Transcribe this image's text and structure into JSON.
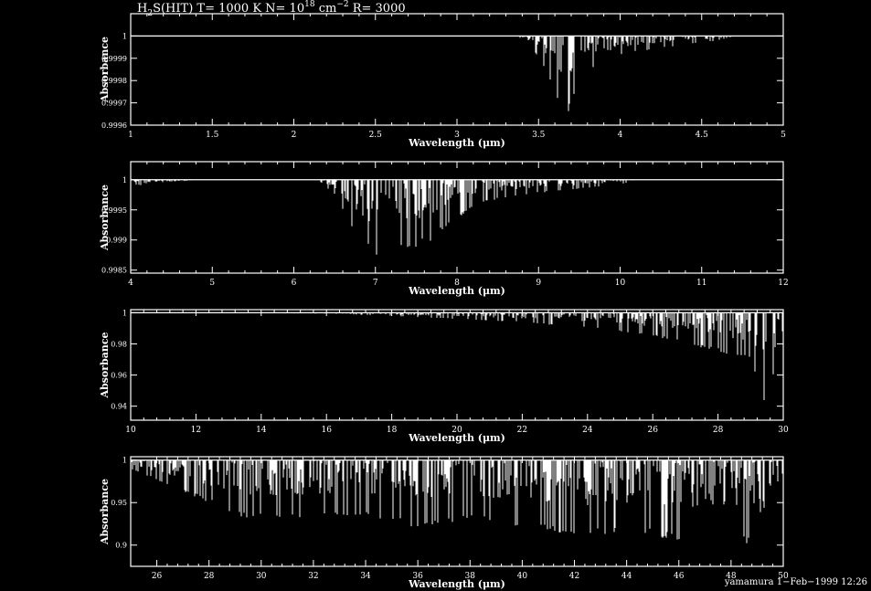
{
  "title": {
    "species": "H",
    "sub": "2",
    "rest": "S(HIT) T= 1000 K N= 10",
    "exp1": "18",
    "unit": " cm",
    "exp2": "−2",
    "res": " R= 3000"
  },
  "footer": "yamamura  1−Feb−1999 12:26",
  "colors": {
    "background": "#000000",
    "foreground": "#ffffff"
  },
  "chart_data": [
    {
      "type": "line",
      "xlabel": "Wavelength (μm)",
      "ylabel": "Absorbance",
      "xlim": [
        1,
        5
      ],
      "ylim": [
        0.9996,
        1.0001
      ],
      "xticks": [
        1,
        1.5,
        2,
        2.5,
        3,
        3.5,
        4,
        4.5,
        5
      ],
      "xtick_labels": [
        "1",
        "1.5",
        "2",
        "2.5",
        "3",
        "3.5",
        "4",
        "4.5",
        "5"
      ],
      "yticks": [
        0.9996,
        0.9997,
        0.9998,
        0.9999,
        1
      ],
      "ytick_labels": [
        "0.9996",
        "0.9997",
        "0.9998",
        "0.9999",
        "1"
      ],
      "band_envelope": {
        "x": [
          1.0,
          3.3,
          3.4,
          3.45,
          3.5,
          3.55,
          3.6,
          3.63,
          3.66,
          3.7,
          3.75,
          3.8,
          3.9,
          4.0,
          4.1,
          4.2,
          4.3,
          4.4,
          4.5,
          4.6,
          4.7,
          5.0
        ],
        "y": [
          1.0,
          1.0,
          0.99999,
          0.99996,
          0.9999,
          0.99983,
          0.99975,
          0.99968,
          0.99962,
          0.99969,
          0.99978,
          0.99984,
          0.99988,
          0.99991,
          0.99993,
          0.99994,
          0.99995,
          0.99996,
          0.99997,
          0.99998,
          1.0,
          1.0
        ]
      }
    },
    {
      "type": "line",
      "xlabel": "Wavelength (μm)",
      "ylabel": "Absorbance",
      "xlim": [
        4,
        12
      ],
      "ylim": [
        0.99845,
        1.0003
      ],
      "xticks": [
        4,
        5,
        6,
        7,
        8,
        9,
        10,
        11,
        12
      ],
      "xtick_labels": [
        "4",
        "5",
        "6",
        "7",
        "8",
        "9",
        "10",
        "11",
        "12"
      ],
      "yticks": [
        0.9985,
        0.999,
        0.9995,
        1
      ],
      "ytick_labels": [
        "0.9985",
        "0.999",
        "0.9995",
        "1"
      ],
      "band_envelope": {
        "x": [
          4.0,
          4.2,
          4.4,
          4.6,
          4.8,
          6.3,
          6.5,
          6.8,
          7.0,
          7.2,
          7.5,
          7.7,
          8.0,
          8.2,
          8.5,
          9.0,
          9.5,
          10.0,
          10.2,
          12.0
        ],
        "y": [
          0.99992,
          0.9999,
          0.99992,
          0.99997,
          1.0,
          1.0,
          0.99975,
          0.999,
          0.99875,
          0.9988,
          0.99888,
          0.999,
          0.99935,
          0.99955,
          0.99968,
          0.99978,
          0.99985,
          0.99992,
          1.0,
          1.0
        ]
      }
    },
    {
      "type": "line",
      "xlabel": "Wavelength (μm)",
      "ylabel": "Absorbance",
      "xlim": [
        10,
        30
      ],
      "ylim": [
        0.931,
        1.002
      ],
      "xticks": [
        10,
        12,
        14,
        16,
        18,
        20,
        22,
        24,
        26,
        28,
        30
      ],
      "xtick_labels": [
        "10",
        "12",
        "14",
        "16",
        "18",
        "20",
        "22",
        "24",
        "26",
        "28",
        "30"
      ],
      "yticks": [
        0.94,
        0.96,
        0.98,
        1
      ],
      "ytick_labels": [
        "0.94",
        "0.96",
        "0.98",
        "1"
      ],
      "band_envelope": {
        "x": [
          10,
          16,
          18,
          20,
          22,
          24,
          25,
          26,
          27,
          28,
          29,
          29.5,
          30
        ],
        "y": [
          1.0,
          0.9995,
          0.998,
          0.996,
          0.994,
          0.99,
          0.988,
          0.985,
          0.98,
          0.975,
          0.97,
          0.935,
          0.99
        ]
      }
    },
    {
      "type": "line",
      "xlabel": "Wavelength (μm)",
      "ylabel": "Absorbance",
      "xlim": [
        25,
        50
      ],
      "ylim": [
        0.875,
        1.004
      ],
      "xticks": [
        26,
        28,
        30,
        32,
        34,
        36,
        38,
        40,
        42,
        44,
        46,
        48,
        50
      ],
      "xtick_labels": [
        "26",
        "28",
        "30",
        "32",
        "34",
        "36",
        "38",
        "40",
        "42",
        "44",
        "46",
        "48",
        "50"
      ],
      "yticks": [
        0.9,
        0.95,
        1
      ],
      "ytick_labels": [
        "0.9",
        "0.95",
        "1"
      ],
      "band_envelope": {
        "x": [
          25,
          29.5,
          34,
          36,
          38,
          40,
          42,
          44,
          46,
          48,
          49.8,
          50
        ],
        "y": [
          0.99,
          0.93,
          0.935,
          0.92,
          0.93,
          0.92,
          0.91,
          0.915,
          0.905,
          0.91,
          0.885,
          0.99
        ]
      }
    }
  ]
}
